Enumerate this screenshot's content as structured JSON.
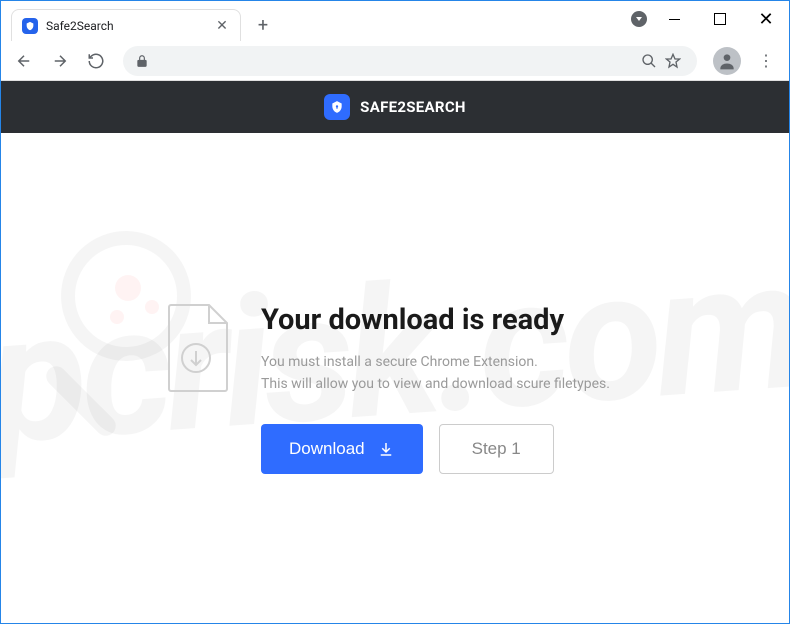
{
  "window": {
    "tab_title": "Safe2Search"
  },
  "header": {
    "brand_name": "SAFE2SEARCH"
  },
  "main": {
    "heading": "Your download is ready",
    "line1": "You must install a secure Chrome Extension.",
    "line2": "This will allow you to view and download scure filetypes.",
    "download_label": "Download",
    "step_label": "Step 1"
  },
  "watermark": {
    "text": "pcrisk.com"
  }
}
